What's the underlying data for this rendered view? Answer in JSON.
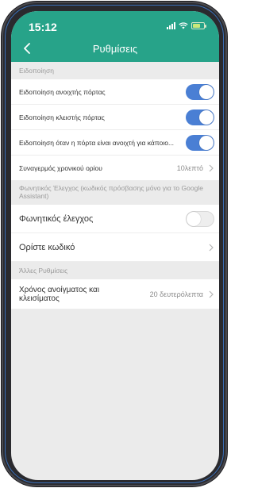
{
  "status_bar": {
    "time": "15:12"
  },
  "header": {
    "title": "Ρυθμίσεις"
  },
  "sections": {
    "notifications": {
      "title": "Ειδοποίηση",
      "items": [
        {
          "label": "Ειδοποίηση ανοιχτής πόρτας",
          "enabled": true
        },
        {
          "label": "Ειδοποίηση κλειστής πόρτας",
          "enabled": true
        },
        {
          "label": "Ειδοποίηση όταν η πόρτα είναι ανοιχτή για κάποιο...",
          "enabled": true
        }
      ],
      "timer_alarm": {
        "label": "Συναγερμός χρονικού ορίου",
        "value": "10λεπτό"
      }
    },
    "voice": {
      "title": "Φωνητικός Έλεγχος (κωδικός πρόσβασης μόνο για το Google Assistant)",
      "toggle": {
        "label": "Φωνητικός έλεγχος",
        "enabled": false
      },
      "set_code": {
        "label": "Ορίστε κωδικό"
      }
    },
    "other": {
      "title": "Άλλες Ρυθμίσεις",
      "open_close_time": {
        "label": "Χρόνος ανοίγματος και κλεισίματος",
        "value": "20 δευτερόλεπτα"
      }
    }
  },
  "colors": {
    "header": "#27a389",
    "toggle_on": "#4a7fd4",
    "background": "#ebebeb"
  }
}
